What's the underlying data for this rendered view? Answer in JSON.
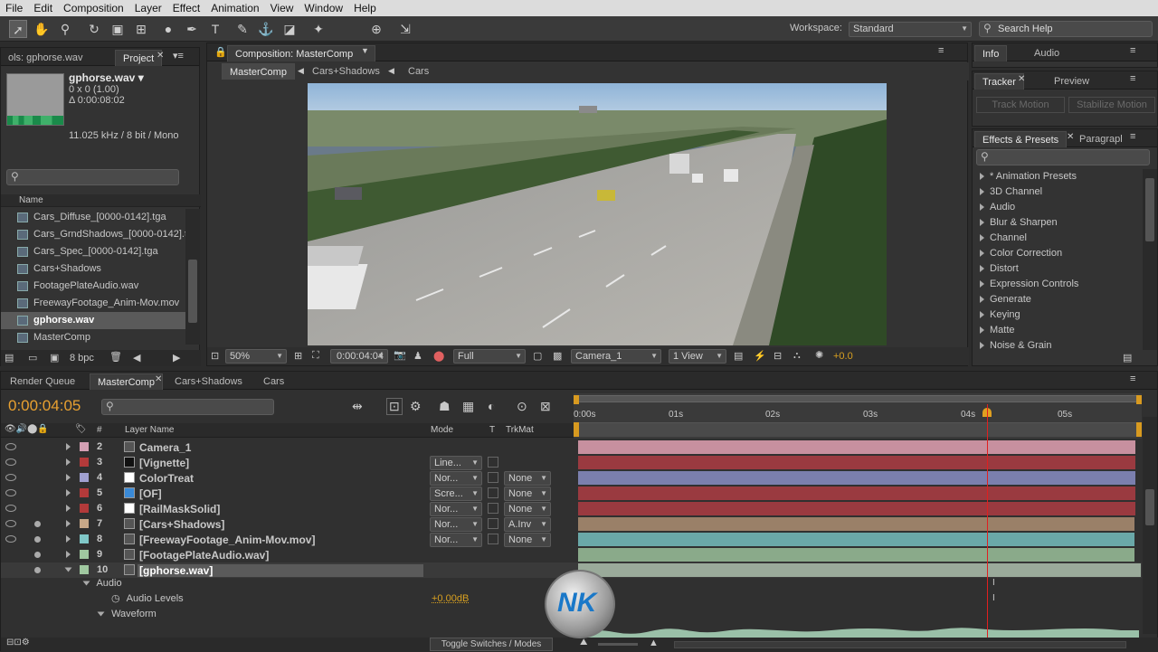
{
  "menu": [
    "File",
    "Edit",
    "Composition",
    "Layer",
    "Effect",
    "Animation",
    "View",
    "Window",
    "Help"
  ],
  "toolbar": {
    "workspace_label": "Workspace:",
    "workspace_value": "Standard",
    "search_help": "Search Help"
  },
  "project": {
    "tab_left": "ols: gphorse.wav",
    "tab_project": "Project",
    "selected_name": "gphorse.wav ▾",
    "dims": "0 x 0 (1.00)",
    "duration": "Δ 0:00:08:02",
    "audio_info": "11.025 kHz / 8 bit / Mono",
    "col_name": "Name",
    "items": [
      "Cars_Diffuse_[0000-0142].tga",
      "Cars_GrndShadows_[0000-0142].t",
      "Cars_Spec_[0000-0142].tga",
      "Cars+Shadows",
      "FootagePlateAudio.wav",
      "FreewayFootage_Anim-Mov.mov",
      "gphorse.wav",
      "MasterComp"
    ],
    "bpc": "8 bpc"
  },
  "comp": {
    "tab": "Composition: MasterComp",
    "crumbs": [
      "MasterComp",
      "Cars+Shadows",
      "Cars"
    ],
    "zoom": "50%",
    "timecode": "0:00:04:04",
    "resolution": "Full",
    "camera": "Camera_1",
    "view": "1 View",
    "exposure": "+0.0"
  },
  "right": {
    "info_tab": "Info",
    "audio_tab": "Audio",
    "tracker_tab": "Tracker",
    "preview_tab": "Preview",
    "track_motion": "Track Motion",
    "stabilize_motion": "Stabilize Motion",
    "effects_tab": "Effects & Presets",
    "paragraph_tab": "Paragrapl",
    "effects": [
      "* Animation Presets",
      "3D Channel",
      "Audio",
      "Blur & Sharpen",
      "Channel",
      "Color Correction",
      "Distort",
      "Expression Controls",
      "Generate",
      "Keying",
      "Matte",
      "Noise & Grain"
    ]
  },
  "timeline": {
    "tabs": [
      "Render Queue",
      "MasterComp",
      "Cars+Shadows",
      "Cars"
    ],
    "timecode": "0:00:04:05",
    "col_layer_name": "Layer Name",
    "col_mode": "Mode",
    "col_t": "T",
    "col_trkmat": "TrkMat",
    "col_hash": "#",
    "ruler": [
      "0:00s",
      "01s",
      "02s",
      "03s",
      "04s",
      "05s"
    ],
    "layers": [
      {
        "num": "2",
        "name": "Camera_1",
        "color": "#d4a0b4",
        "mode": "",
        "trk": "",
        "bar": "#c7909f"
      },
      {
        "num": "3",
        "name": "[Vignette]",
        "color": "#b33a3a",
        "mode": "Line...",
        "trk": "",
        "bar": "#9a3a40"
      },
      {
        "num": "4",
        "name": "ColorTreat",
        "color": "#a0a0d0",
        "mode": "Nor...",
        "trk": "None",
        "bar": "#7b7fae"
      },
      {
        "num": "5",
        "name": "[OF]",
        "color": "#b33a3a",
        "mode": "Scre...",
        "trk": "None",
        "bar": "#9a3a40"
      },
      {
        "num": "6",
        "name": "[RailMaskSolid]",
        "color": "#b33a3a",
        "mode": "Nor...",
        "trk": "None",
        "bar": "#9a3a40"
      },
      {
        "num": "7",
        "name": "[Cars+Shadows]",
        "color": "#c8a888",
        "mode": "Nor...",
        "trk": "A.Inv",
        "bar": "#9a8068"
      },
      {
        "num": "8",
        "name": "[FreewayFootage_Anim-Mov.mov]",
        "color": "#80c8c8",
        "mode": "Nor...",
        "trk": "None",
        "bar": "#6aa8a8"
      },
      {
        "num": "9",
        "name": "[FootagePlateAudio.wav]",
        "color": "#a0c8a0",
        "mode": "",
        "trk": "",
        "bar": "#8aaa8a"
      },
      {
        "num": "10",
        "name": "[gphorse.wav]",
        "color": "#a0c8a0",
        "mode": "",
        "trk": "",
        "bar": "#9aaa9a"
      }
    ],
    "audio_group": "Audio",
    "audio_levels": "Audio Levels",
    "audio_levels_value": "+0.00dB",
    "waveform": "Waveform",
    "toggle": "Toggle Switches / Modes"
  },
  "colors": {
    "accent": "#e8a030",
    "playhead": "#e02020"
  }
}
